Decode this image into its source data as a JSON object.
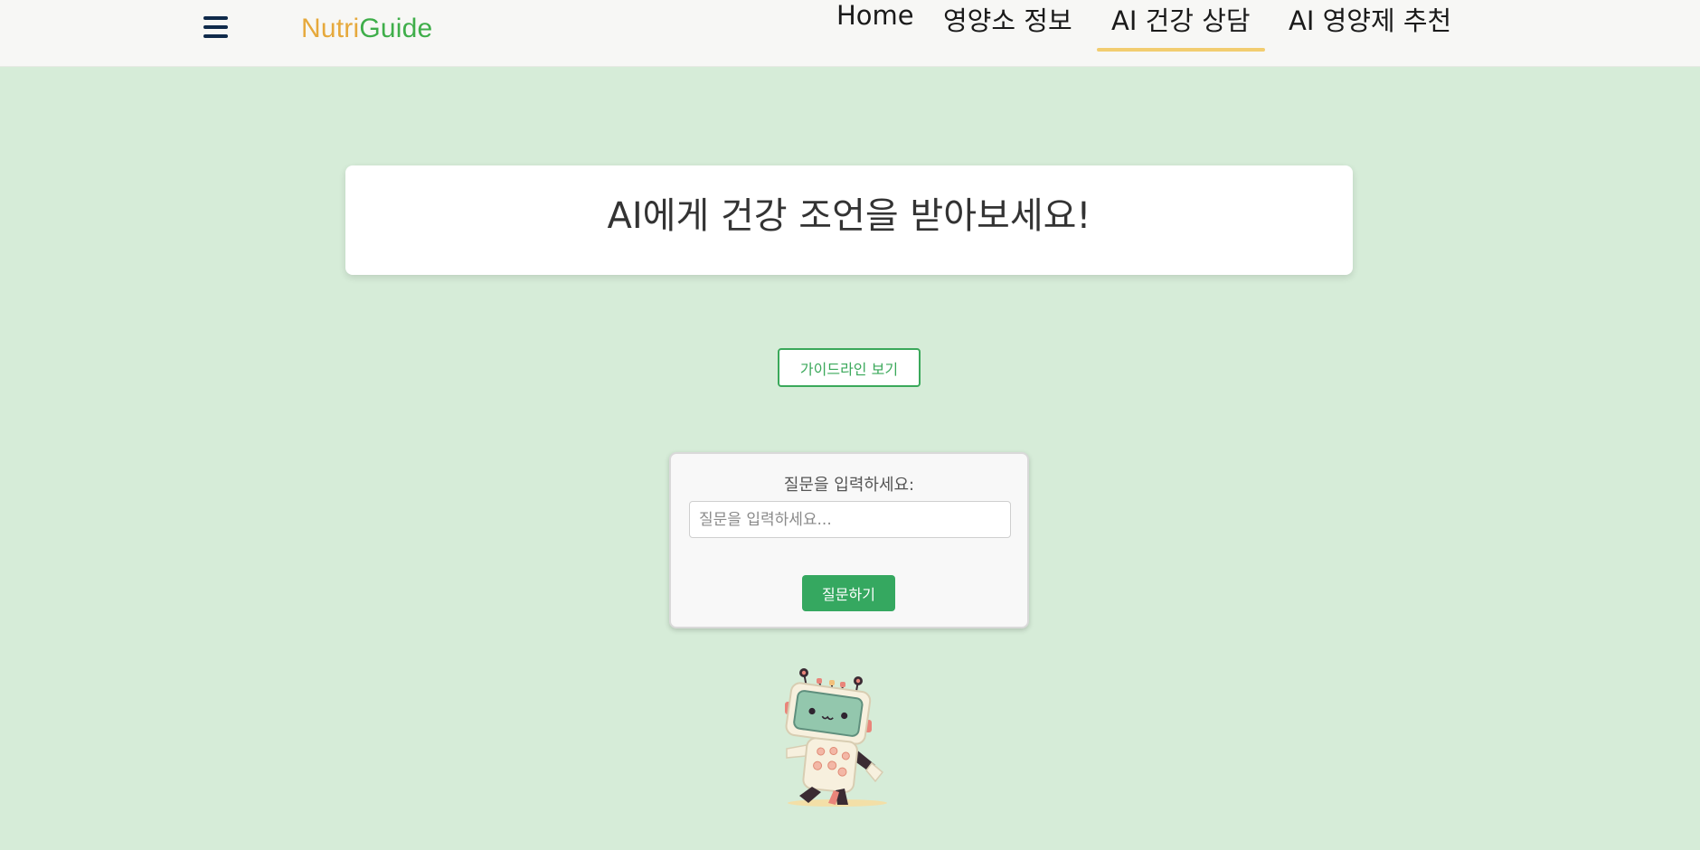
{
  "nav": {
    "logo_part1": "Nutri",
    "logo_part2": "Guide",
    "items": [
      {
        "label": "Home"
      },
      {
        "label": "영양소 정보"
      },
      {
        "label": "AI 건강 상담",
        "active": true
      },
      {
        "label": "AI 영양제 추천"
      }
    ]
  },
  "main": {
    "title": "AI에게 건강 조언을 받아보세요!",
    "guideline_button": "가이드라인 보기",
    "ask_label": "질문을 입력하세요:",
    "ask_placeholder": "질문을 입력하세요...",
    "ask_value": "",
    "ask_button": "질문하기"
  },
  "icons": {
    "menu": "hamburger-menu-icon",
    "mascot": "robot-mascot-illustration"
  },
  "colors": {
    "background": "#d6ecd8",
    "navbar": "#f7f7f5",
    "logo_orange": "#e6a93c",
    "logo_green": "#3fae4a",
    "active_underline": "#f2cd70",
    "primary_green": "#35a860"
  }
}
